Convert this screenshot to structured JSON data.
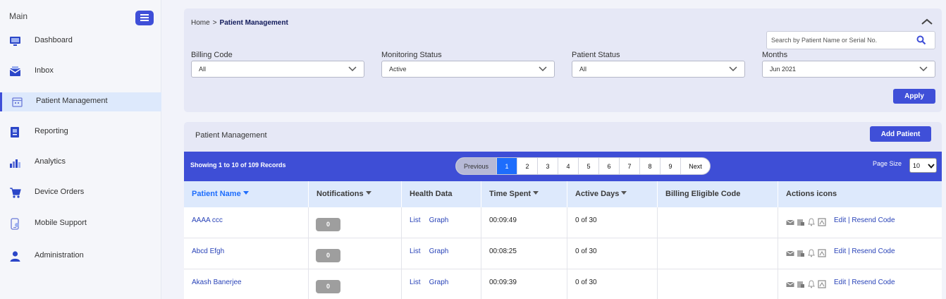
{
  "sidebar": {
    "heading": "Main",
    "items": [
      {
        "label": "Dashboard",
        "icon": "dashboard-icon"
      },
      {
        "label": "Inbox",
        "icon": "inbox-icon"
      },
      {
        "label": "Patient Management",
        "icon": "calendar-icon",
        "active": true
      },
      {
        "label": "Reporting",
        "icon": "report-icon"
      },
      {
        "label": "Analytics",
        "icon": "analytics-icon"
      },
      {
        "label": "Device Orders",
        "icon": "cart-icon"
      },
      {
        "label": "Mobile Support",
        "icon": "mobile-icon"
      },
      {
        "label": "Administration",
        "icon": "user-icon"
      }
    ]
  },
  "breadcrumb": {
    "home": "Home",
    "separator": ">",
    "current": "Patient Management"
  },
  "search": {
    "placeholder": "Search by Patient Name or Serial No."
  },
  "filters": {
    "billing_code": {
      "label": "Billing Code",
      "value": "All"
    },
    "monitoring_status": {
      "label": "Monitoring Status",
      "value": "Active"
    },
    "patient_status": {
      "label": "Patient Status",
      "value": "All"
    },
    "months": {
      "label": "Months",
      "value": "Jun 2021"
    },
    "apply_label": "Apply"
  },
  "panel": {
    "title": "Patient Management",
    "add_label": "Add Patient"
  },
  "pagination": {
    "showing": "Showing 1 to 10 of 109 Records",
    "previous": "Previous",
    "pages": [
      "1",
      "2",
      "3",
      "4",
      "5",
      "6",
      "7",
      "8",
      "9"
    ],
    "current_page": "1",
    "next": "Next",
    "page_size_label": "Page Size",
    "page_size": "10"
  },
  "table": {
    "headers": {
      "patient_name": "Patient Name",
      "notifications": "Notifications",
      "health_data": "Health Data",
      "time_spent": "Time Spent",
      "active_days": "Active Days",
      "billing_code": "Billing Eligible Code",
      "actions": "Actions icons"
    },
    "rows": [
      {
        "name": "AAAA ccc",
        "notifications": "0",
        "list": "List",
        "graph": "Graph",
        "time": "00:09:49",
        "days": "0 of 30",
        "billing": "",
        "actions": "Edit | Resend Code"
      },
      {
        "name": "Abcd Efgh",
        "notifications": "0",
        "list": "List",
        "graph": "Graph",
        "time": "00:08:25",
        "days": "0 of 30",
        "billing": "",
        "actions": "Edit | Resend Code"
      },
      {
        "name": "Akash Banerjee",
        "notifications": "0",
        "list": "List",
        "graph": "Graph",
        "time": "00:09:39",
        "days": "0 of 30",
        "billing": "",
        "actions": "Edit | Resend Code"
      }
    ]
  },
  "colors": {
    "primary": "#3f4fd8",
    "link": "#2943b8",
    "active_page": "#1e6dfc",
    "header_bg": "#dde9fc"
  }
}
